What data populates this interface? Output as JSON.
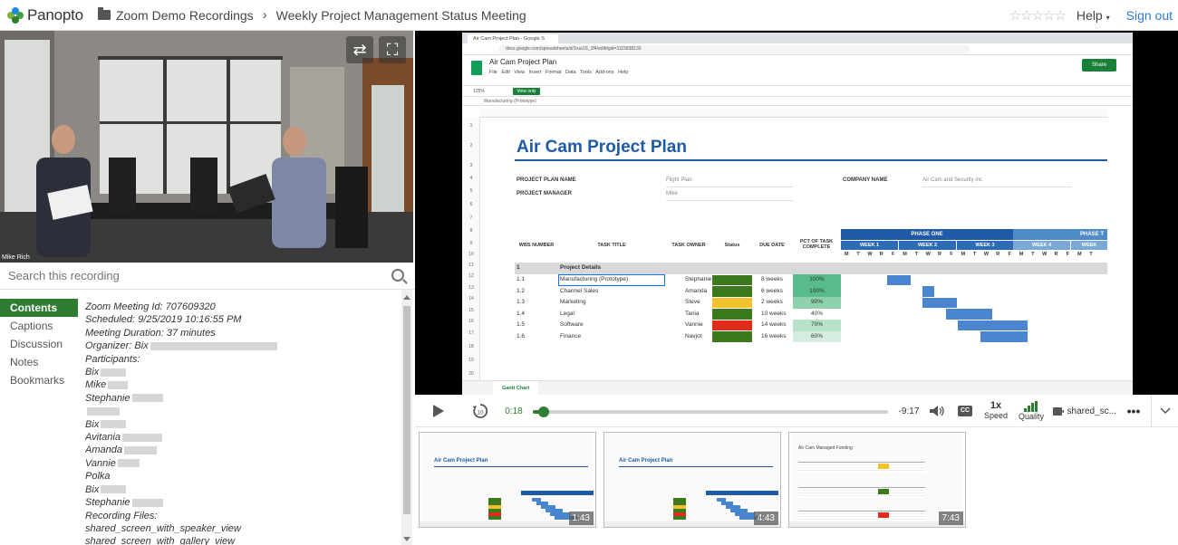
{
  "app": {
    "brand": "Panopto",
    "breadcrumb": [
      "Zoom Demo Recordings",
      "Weekly Project Management Status Meeting"
    ],
    "rating_stars": "☆☆☆☆☆",
    "help_label": "Help",
    "signout_label": "Sign out"
  },
  "camera": {
    "name_label": "Mike Rich"
  },
  "search": {
    "placeholder": "Search this recording"
  },
  "tabs": [
    {
      "label": "Contents",
      "active": true
    },
    {
      "label": "Captions"
    },
    {
      "label": "Discussion"
    },
    {
      "label": "Notes"
    },
    {
      "label": "Bookmarks"
    }
  ],
  "contents": {
    "meeting_id": "Zoom Meeting Id: 707609320",
    "scheduled": "Scheduled: 9/25/2019 10:16:55 PM",
    "duration": "Meeting Duration: 37 minutes",
    "organizer": "Organizer: Bix",
    "participants_label": "Participants:",
    "participants": [
      "Bix",
      "Mike",
      "Stephanie",
      "",
      "Bix",
      "Avitania",
      "Amanda",
      "Vannie",
      "Polka",
      "Bix",
      "Stephanie"
    ],
    "recording_files_label": "Recording Files:",
    "files": [
      "shared_screen_with_speaker_view",
      "shared_screen_with_gallery_view"
    ]
  },
  "sheet": {
    "browser_tab": "Air Cam Project Plan - Google S",
    "url": "docs.google.com/spreadsheets/d/1rua1S_3f4/edit#gid=1115838130",
    "doc_title": "Air Cam Project Plan",
    "menu": "File Edit View Insert Format Data Tools Add-ons Help",
    "share_label": "Share",
    "zoom": "125%",
    "view_only": "View only",
    "formula": "Manufacturing (Prototype)",
    "plan_title": "Air Cam Project Plan",
    "project_plan_name_label": "PROJECT PLAN NAME",
    "project_plan_name": "Flight Plan",
    "project_manager_label": "PROJECT MANAGER",
    "project_manager": "Mike",
    "company_name_label": "COMPANY NAME",
    "company_name": "Air Cam and Security inc",
    "headers": [
      "WBS NUMBER",
      "TASK TITLE",
      "TASK OWNER",
      "Status",
      "DUE DATE",
      "PCT OF TASK COMPLETE"
    ],
    "phase_one": "PHASE ONE",
    "phase_two": "PHASE T",
    "weeks": [
      "WEEK 1",
      "WEEK 2",
      "WEEK 3",
      "WEEK 4",
      "WEEK"
    ],
    "days": [
      "M",
      "T",
      "W",
      "R",
      "F",
      "M",
      "T",
      "W",
      "R",
      "F",
      "M",
      "T",
      "W",
      "R",
      "F",
      "M",
      "T",
      "W",
      "R",
      "F",
      "M",
      "T"
    ],
    "section": {
      "wbs": "1",
      "title": "Project Details"
    },
    "tasks": [
      {
        "wbs": "1.1",
        "title": "Manufacturing (Prototype)",
        "owner": "Stephanie",
        "status": "#3d7a1e",
        "due": "8 weeks",
        "pct": "100%"
      },
      {
        "wbs": "1.2",
        "title": "Channel Sales",
        "owner": "Amanda",
        "status": "#3d7a1e",
        "due": "6 weeks",
        "pct": "100%"
      },
      {
        "wbs": "1.3",
        "title": "Marketing",
        "owner": "Steve",
        "status": "#f2c12e",
        "due": "2 weeks",
        "pct": "90%"
      },
      {
        "wbs": "1.4",
        "title": "Legal",
        "owner": "Tania",
        "status": "#3d7a1e",
        "due": "10 weeks",
        "pct": "40%"
      },
      {
        "wbs": "1.5",
        "title": "Software",
        "owner": "Vannie",
        "status": "#e02b1a",
        "due": "14 weeks",
        "pct": "70%"
      },
      {
        "wbs": "1.6",
        "title": "Finance",
        "owner": "Navjot",
        "status": "#3d7a1e",
        "due": "16 weeks",
        "pct": "60%"
      }
    ],
    "sheet_tab": "Gantt Chart"
  },
  "player": {
    "current_time": "0:18",
    "remaining_time": "-9:17",
    "progress_fraction": 0.03,
    "speed_value": "1x",
    "speed_label": "Speed",
    "quality_label": "Quality",
    "stream_label": "shared_sc..."
  },
  "thumbs": [
    {
      "time": "1:43",
      "title": "Air Cam Project Plan"
    },
    {
      "time": "4:43",
      "title": "Air Cam Project Plan"
    },
    {
      "time": "7:43",
      "title": "Air Cam Managed Funding"
    }
  ],
  "colors": {
    "accent": "#2e7d32",
    "link": "#2a7bd3",
    "sheet_blue": "#1f5aa6"
  }
}
